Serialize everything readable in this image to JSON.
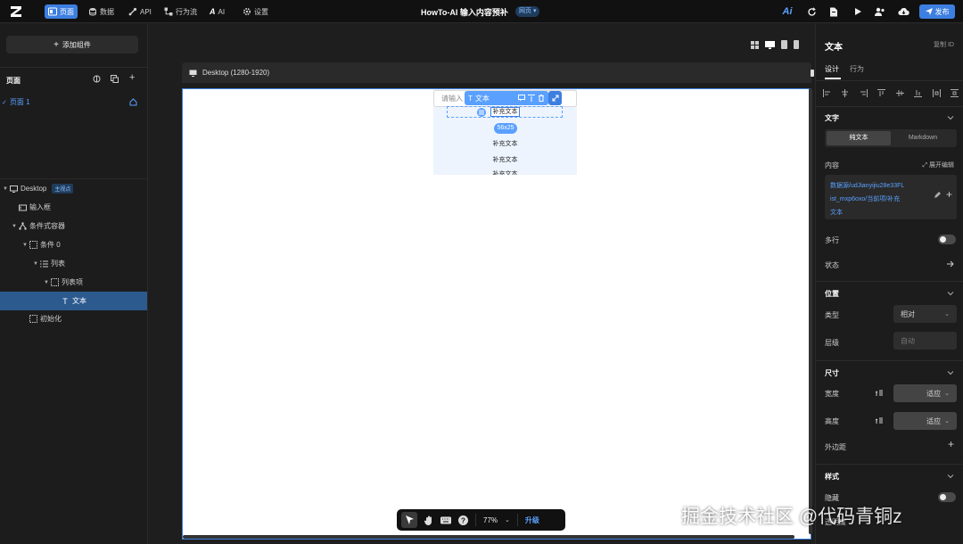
{
  "topbar": {
    "nav": [
      {
        "label": "页面",
        "icon": "pages-icon",
        "active": true
      },
      {
        "label": "数据",
        "icon": "database-icon"
      },
      {
        "label": "API",
        "icon": "api-icon"
      },
      {
        "label": "行为流",
        "icon": "workflow-icon"
      },
      {
        "label": "AI",
        "icon": "ai-icon"
      },
      {
        "label": "设置",
        "icon": "settings-icon"
      }
    ],
    "title": "HowTo-AI 输入内容预补",
    "platform_badge": "网页",
    "publish_label": "发布"
  },
  "left": {
    "add_component": "添加组件",
    "pages_title": "页面",
    "page_item": "页面 1",
    "tree": [
      {
        "label": "Desktop",
        "badge": "主视点"
      },
      {
        "label": "输入框"
      },
      {
        "label": "条件式容器"
      },
      {
        "label": "条件 0"
      },
      {
        "label": "列表"
      },
      {
        "label": "列表项"
      },
      {
        "label": "文本",
        "selected": true
      },
      {
        "label": "初始化"
      }
    ]
  },
  "center": {
    "viewport_label": "Desktop (1280-1920)",
    "input_placeholder": "请输入",
    "float_toolbar_label": "文本",
    "size_badge": "56x25",
    "list_items": [
      "补充文本",
      "补充文本",
      "补充文本",
      "补充文本"
    ],
    "zoom": "77%",
    "upgrade_label": "升级"
  },
  "right": {
    "title": "文本",
    "copy_id": "复制 ID",
    "tabs": [
      "设计",
      "行为"
    ],
    "text_section": "文字",
    "text_modes": [
      "纯文本",
      "Markdown"
    ],
    "content_label": "内容",
    "expand_edit": "展开编辑",
    "content_value_lines": [
      "数据源/udJianyijiu28e33FL",
      "ist_mxp6oxo/当前项/补充",
      "文本"
    ],
    "multiline_label": "多行",
    "state_label": "状态",
    "position_section": "位置",
    "type_label": "类型",
    "type_value": "相对",
    "layer_label": "层级",
    "layer_placeholder": "自动",
    "size_section": "尺寸",
    "width_label": "宽度",
    "width_value": "适应",
    "height_label": "高度",
    "height_value": "适应",
    "margin_label": "外边距",
    "style_section": "样式",
    "hidden_label": "隐藏",
    "opacity_label": "透明度"
  },
  "watermark": "掘金技术社区 @代码青铜z",
  "colors": {
    "accent": "#3d7fe0",
    "panel": "#1c1c1c",
    "canvas": "#ffffff",
    "selected_row": "#2c5a8f"
  }
}
